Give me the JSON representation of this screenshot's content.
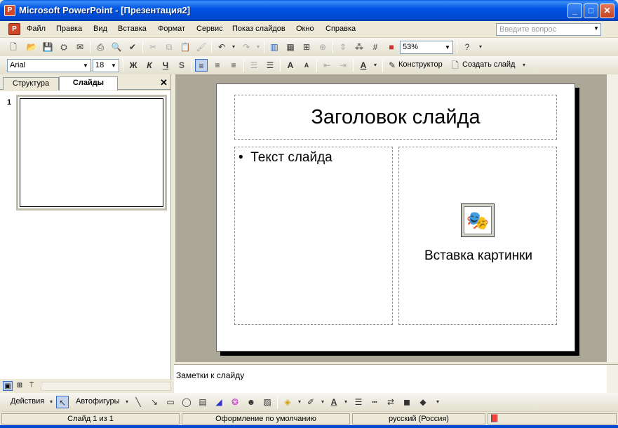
{
  "window": {
    "title": "Microsoft PowerPoint - [Презентация2]",
    "app_icon": "P",
    "minimize": "_",
    "maximize": "□",
    "close": "✕"
  },
  "menu": {
    "items": [
      "Файл",
      "Правка",
      "Вид",
      "Вставка",
      "Формат",
      "Сервис",
      "Показ слайдов",
      "Окно",
      "Справка"
    ],
    "ask_placeholder": "Введите вопрос"
  },
  "toolbar1": {
    "zoom": "53%",
    "icons": [
      "new-icon",
      "open-icon",
      "save-icon",
      "permission-icon",
      "email-icon",
      "print-icon",
      "print-preview-icon",
      "spelling-icon",
      "cut-icon",
      "copy-icon",
      "paste-icon",
      "format-painter-icon",
      "undo-icon",
      "redo-icon",
      "chart-icon",
      "table-icon",
      "tables-borders-icon",
      "hyperlink-icon",
      "expand-icon",
      "show-formatting-icon",
      "grid-icon",
      "color-grayscale-icon",
      "help-icon"
    ]
  },
  "toolbar2": {
    "font": "Arial",
    "size": "18",
    "bold": "Ж",
    "italic": "К",
    "underline": "Ч",
    "shadow": "S",
    "font_color_letter": "A",
    "designer": "Конструктор",
    "new_slide": "Создать слайд"
  },
  "leftpane": {
    "tabs": [
      "Структура",
      "Слайды"
    ],
    "active_tab": "Слайды",
    "close": "✕",
    "slide_number": "1"
  },
  "slide": {
    "title": "Заголовок слайда",
    "bullet": "•",
    "body": "Текст слайда",
    "clipart_label": "Вставка картинки"
  },
  "notes": {
    "placeholder": "Заметки к слайду"
  },
  "drawbar": {
    "actions": "Действия",
    "autoshapes": "Автофигуры"
  },
  "status": {
    "slide": "Слайд 1 из 1",
    "design": "Оформление по умолчанию",
    "language": "русский (Россия)"
  }
}
